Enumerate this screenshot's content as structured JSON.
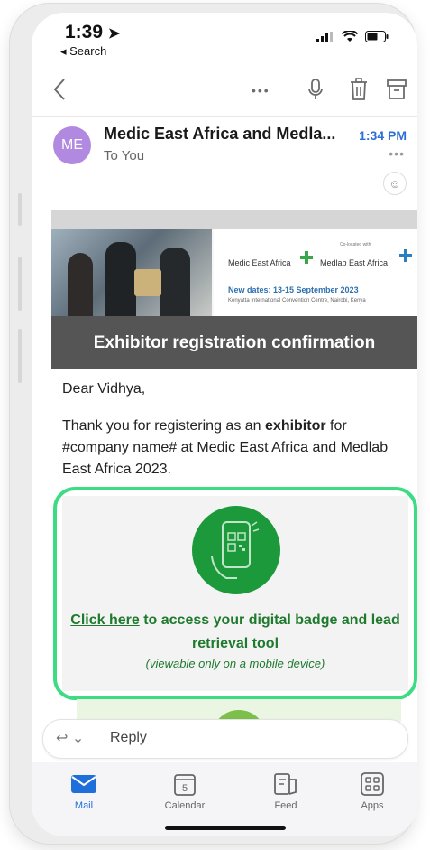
{
  "status_bar": {
    "time": "1:39",
    "back_app": "◂ Search"
  },
  "toolbar": {
    "back_icon": "chevron-left-icon",
    "more_icon": "more-horizontal-icon",
    "mic_icon": "microphone-icon",
    "delete_icon": "trash-icon",
    "archive_icon": "archive-icon"
  },
  "email": {
    "avatar_initials": "ME",
    "avatar_color": "#b189e0",
    "sender": "Medic East Africa and Medla...",
    "to": "To You",
    "time": "1:34 PM",
    "more": "•••"
  },
  "banner": {
    "medic_logo": "Medic East Africa",
    "medlab_logo": "Medlab East Africa",
    "co_located": "Co-located with",
    "new_dates": "New dates: 13-15 September 2023",
    "venue": "Kenyatta International Convention Centre, Nairobi, Kenya",
    "title": "Exhibitor registration confirmation"
  },
  "body": {
    "greeting": "Dear Vidhya,",
    "para_part1": "Thank you for registering as an ",
    "para_bold": "exhibitor",
    "para_part2": " for #company name# at Medic East Africa and Medlab East Africa 2023."
  },
  "badge_card": {
    "link_text": "Click here",
    "link_rest": " to access your digital badge and lead retrieval tool",
    "note": "(viewable only on a mobile device)",
    "accent": "#1c9a3b",
    "border": "#3ddc84"
  },
  "reply": {
    "label": "Reply"
  },
  "tabs": [
    {
      "label": "Mail",
      "icon": "mail-icon",
      "active": true
    },
    {
      "label": "Calendar",
      "icon": "calendar-icon",
      "badge": "5"
    },
    {
      "label": "Feed",
      "icon": "feed-icon"
    },
    {
      "label": "Apps",
      "icon": "apps-icon"
    }
  ]
}
